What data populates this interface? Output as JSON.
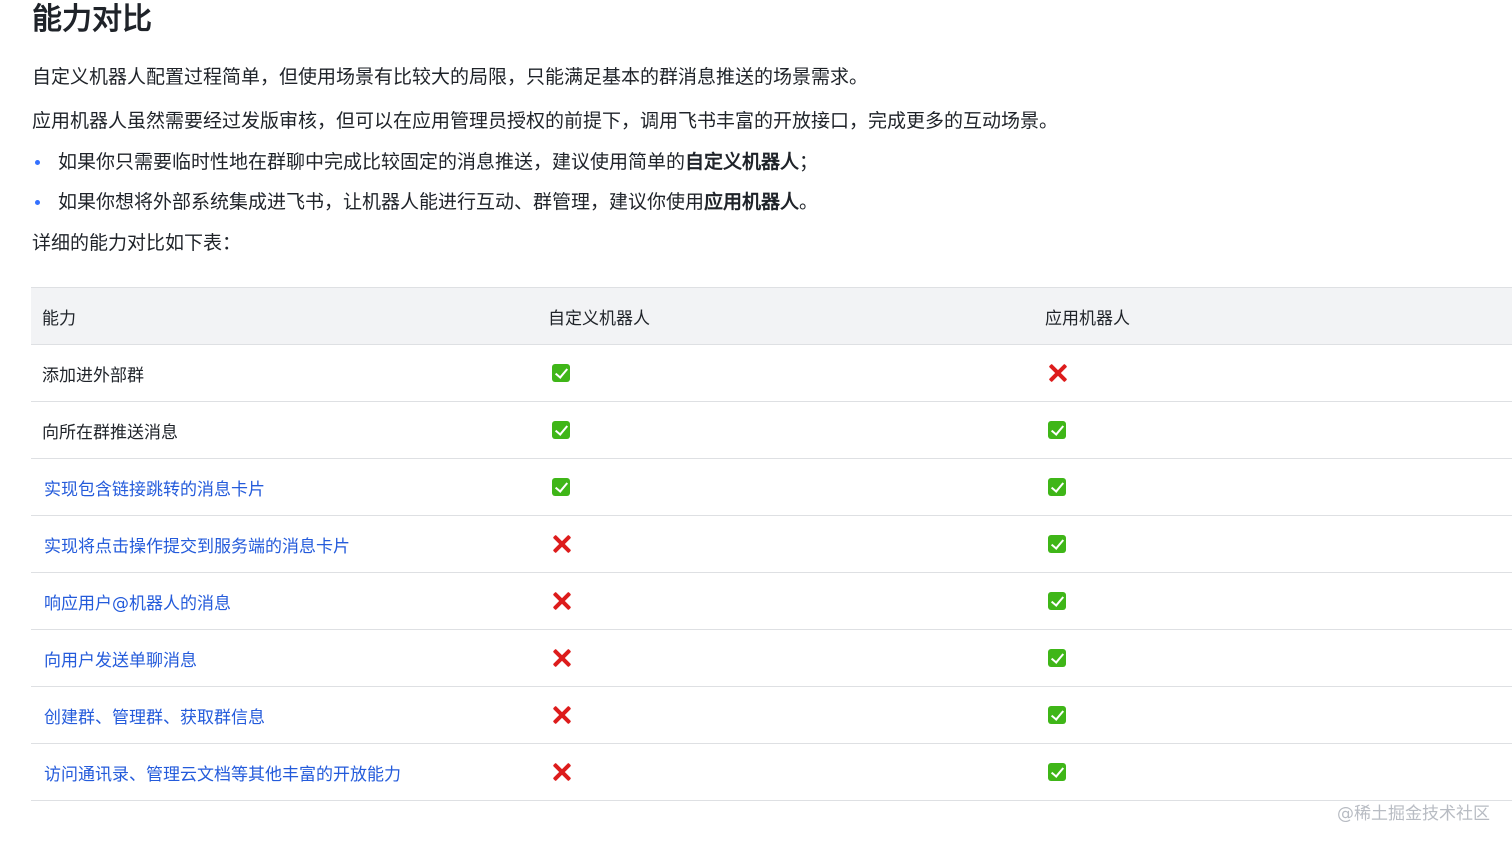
{
  "title": "能力对比",
  "intro": [
    "自定义机器人配置过程简单，但使用场景有比较大的局限，只能满足基本的群消息推送的场景需求。",
    "应用机器人虽然需要经过发版审核，但可以在应用管理员授权的前提下，调用飞书丰富的开放接口，完成更多的互动场景。"
  ],
  "bullets": [
    {
      "text": "如果你只需要临时性地在群聊中完成比较固定的消息推送，建议使用简单的",
      "bold": "自定义机器人",
      "suffix": "；"
    },
    {
      "text": "如果你想将外部系统集成进飞书，让机器人能进行互动、群管理，建议你使用",
      "bold": "应用机器人",
      "suffix": "。"
    }
  ],
  "table_intro": "详细的能力对比如下表：",
  "table": {
    "headers": [
      "能力",
      "自定义机器人",
      "应用机器人"
    ],
    "rows": [
      {
        "feature": "添加进外部群",
        "link": false,
        "custom": "yes",
        "app": "no"
      },
      {
        "feature": "向所在群推送消息",
        "link": false,
        "custom": "yes",
        "app": "yes"
      },
      {
        "feature": "实现包含链接跳转的消息卡片",
        "link": true,
        "custom": "yes",
        "app": "yes"
      },
      {
        "feature": "实现将点击操作提交到服务端的消息卡片",
        "link": true,
        "custom": "no",
        "app": "yes"
      },
      {
        "feature": "响应用户@机器人的消息",
        "link": true,
        "custom": "no",
        "app": "yes"
      },
      {
        "feature": "向用户发送单聊消息",
        "link": true,
        "custom": "no",
        "app": "yes"
      },
      {
        "feature": "创建群、管理群、获取群信息",
        "link": true,
        "custom": "no",
        "app": "yes"
      },
      {
        "feature": "访问通讯录、管理云文档等其他丰富的开放能力",
        "link": true,
        "custom": "no",
        "app": "yes"
      }
    ]
  },
  "icons": {
    "yes": "check-mark-button-icon",
    "no": "cross-mark-icon"
  },
  "colors": {
    "link": "#245bdb",
    "yes": "#3fb618",
    "no": "#dd1c1c",
    "header_bg": "#f2f3f5"
  },
  "watermark": "@稀土掘金技术社区"
}
